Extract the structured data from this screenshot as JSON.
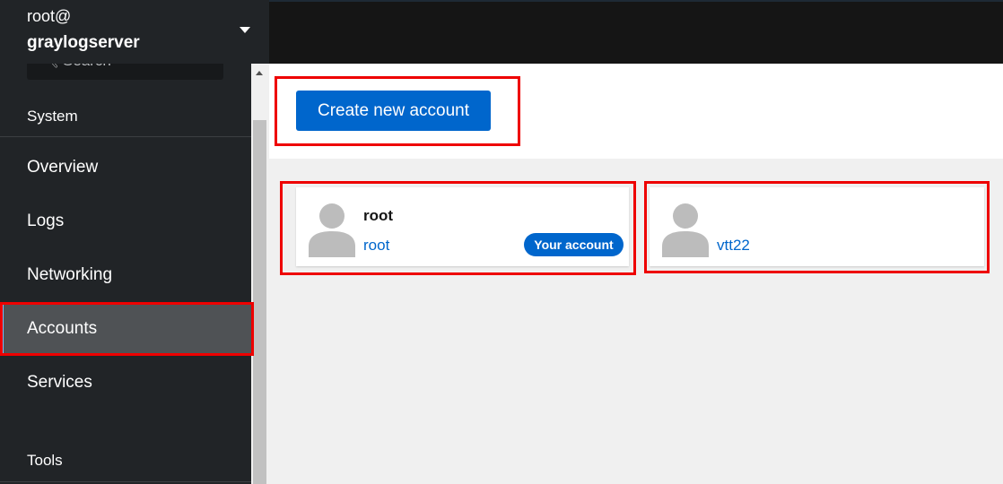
{
  "host": {
    "user": "root@",
    "name": "graylogserver"
  },
  "search": {
    "placeholder": "Search"
  },
  "sidebar": {
    "section_system": "System",
    "items": [
      {
        "label": "Overview"
      },
      {
        "label": "Logs"
      },
      {
        "label": "Networking"
      },
      {
        "label": "Accounts",
        "active": true
      },
      {
        "label": "Services"
      }
    ],
    "section_tools": "Tools"
  },
  "main": {
    "create_button": "Create new account",
    "accounts": [
      {
        "full_name": "root",
        "login": "root",
        "badge": "Your account"
      },
      {
        "full_name": "",
        "login": "vtt22"
      }
    ]
  },
  "colors": {
    "accent": "#0066cc",
    "highlight": "#ee0000",
    "sidebar_bg": "#212427"
  }
}
